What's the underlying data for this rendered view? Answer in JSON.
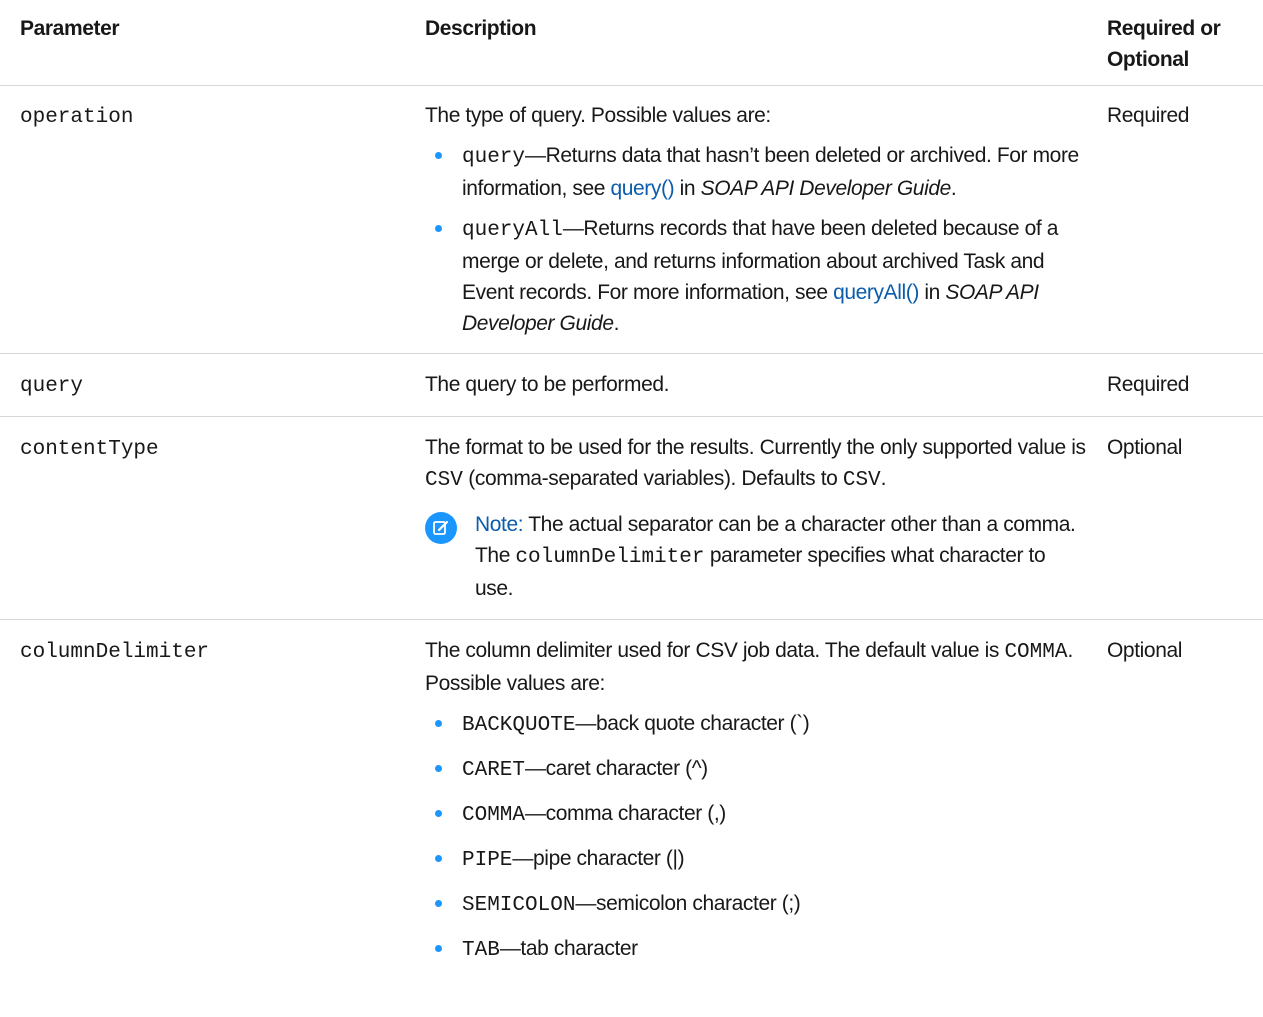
{
  "headers": {
    "parameter": "Parameter",
    "description": "Description",
    "required": "Required or Optional"
  },
  "rows": [
    {
      "param": "operation",
      "required": "Required",
      "desc_intro": "The type of query. Possible values are:",
      "items": [
        {
          "code": "query",
          "text_before": "—Returns data that hasn’t been deleted or archived. For more information, see ",
          "link": "query()",
          "text_mid": " in ",
          "italic": "SOAP API Developer Guide",
          "text_end": "."
        },
        {
          "code": "queryAll",
          "text_before": "—Returns records that have been deleted because of a merge or delete, and returns information about archived Task and Event records. For more information, see ",
          "link": "queryAll()",
          "text_mid": " in ",
          "italic": "SOAP API Developer Guide",
          "text_end": "."
        }
      ]
    },
    {
      "param": "query",
      "required": "Required",
      "desc": "The query to be performed."
    },
    {
      "param": "contentType",
      "required": "Optional",
      "desc_before": "The format to be used for the results. Currently the only supported value is ",
      "code1": "CSV",
      "desc_mid": " (comma-separated variables). Defaults to ",
      "code2": "CSV",
      "desc_end": ".",
      "note_label": "Note:",
      "note_before": " The actual separator can be a character other than a comma. The ",
      "note_code": "columnDelimiter",
      "note_after": " parameter specifies what character to use."
    },
    {
      "param": "columnDelimiter",
      "required": "Optional",
      "desc_before": "The column delimiter used for CSV job data. The default value is ",
      "code": "COMMA",
      "desc_end": ". Possible values are:",
      "items": [
        {
          "code": "BACKQUOTE",
          "text": "—back quote character (`)"
        },
        {
          "code": "CARET",
          "text": "—caret character (^)"
        },
        {
          "code": "COMMA",
          "text": "—comma character (,)"
        },
        {
          "code": "PIPE",
          "text": "—pipe character (|)"
        },
        {
          "code": "SEMICOLON",
          "text": "—semicolon character (;)"
        },
        {
          "code": "TAB",
          "text": "—tab character"
        }
      ]
    }
  ],
  "colors": {
    "accent": "#1b96ff",
    "link": "#0b5cab",
    "rule": "#d6d6d6"
  },
  "icons": {
    "note": "edit-note-icon"
  }
}
